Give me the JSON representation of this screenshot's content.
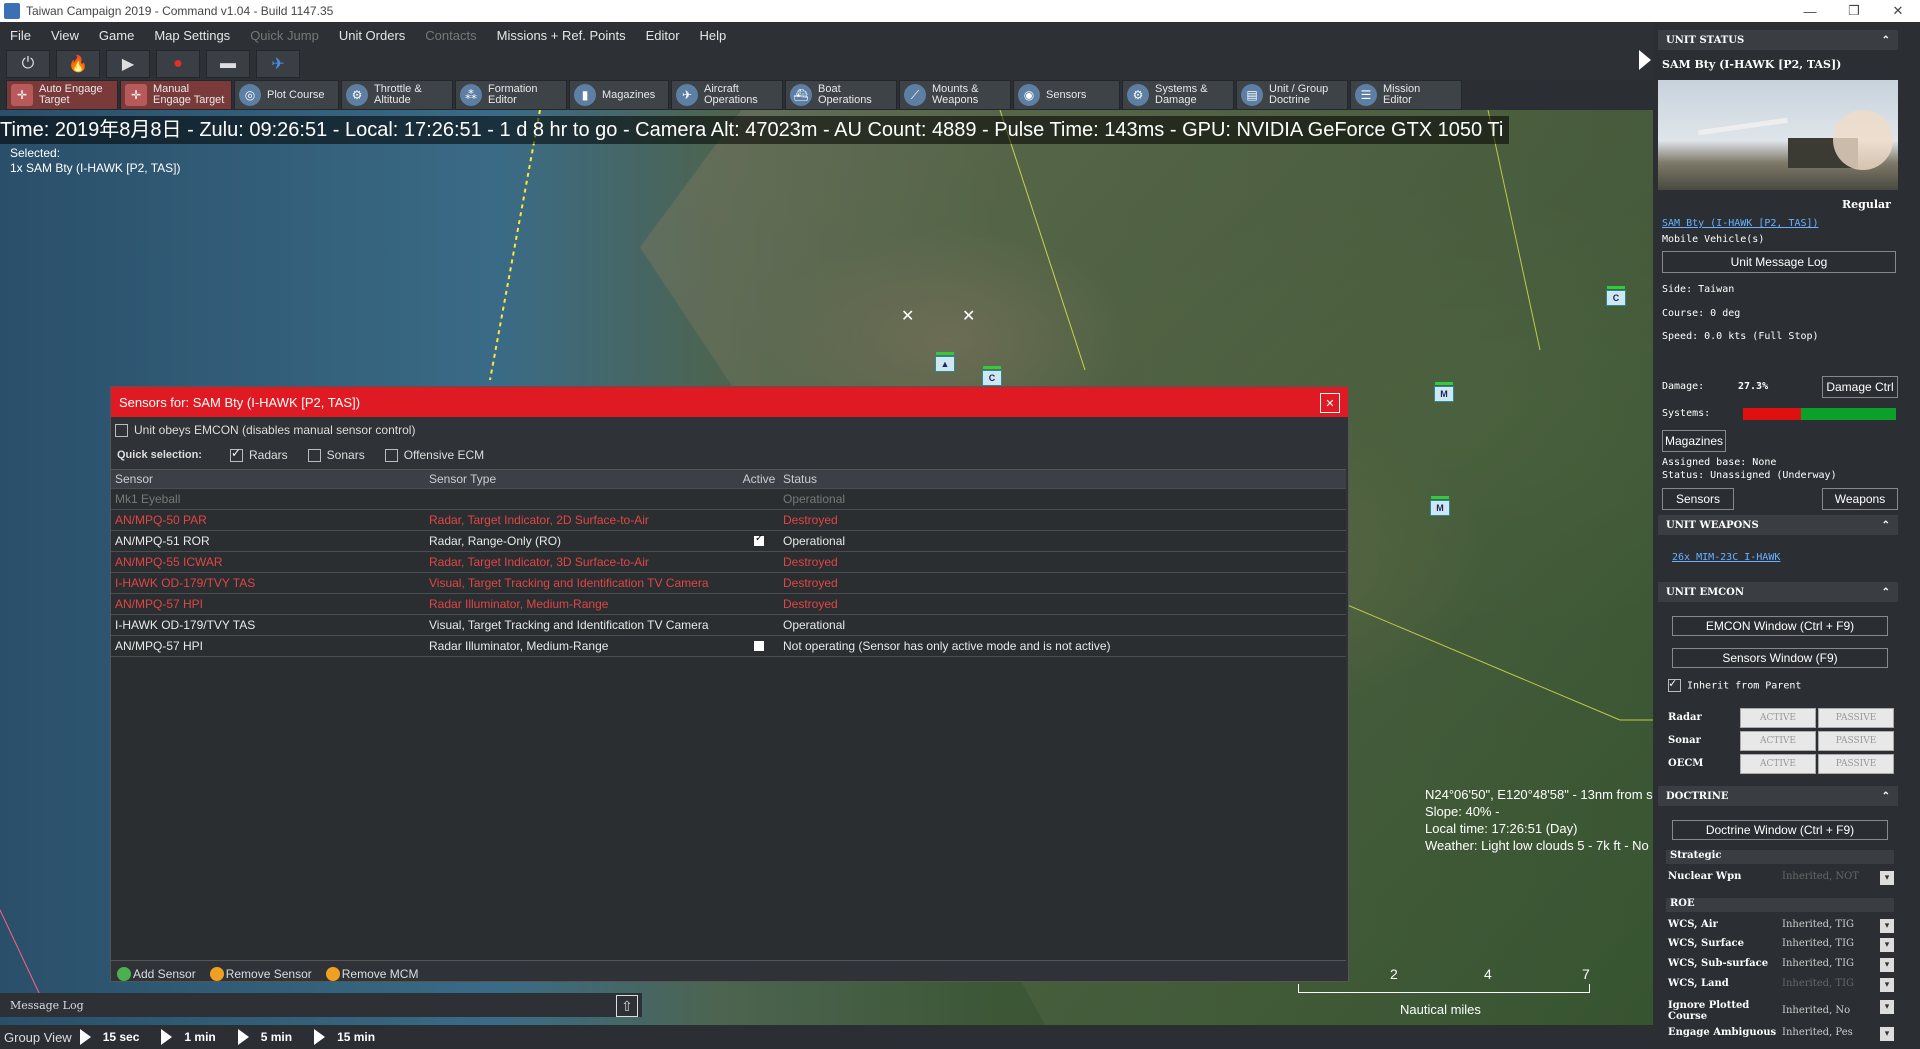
{
  "window": {
    "title": "Taiwan  Campaign 2019 - Command v1.04 - Build 1147.35"
  },
  "menu": [
    "File",
    "View",
    "Game",
    "Map Settings",
    "Quick Jump",
    "Unit Orders",
    "Contacts",
    "Missions + Ref. Points",
    "Editor",
    "Help"
  ],
  "menu_disabled": [
    "Quick Jump",
    "Contacts"
  ],
  "toolbar2": [
    {
      "label": "Auto Engage\nTarget",
      "icon": "crosshair-icon",
      "style": "red"
    },
    {
      "label": "Manual\nEngage Target",
      "icon": "crosshair-icon",
      "style": "red"
    },
    {
      "label": "Plot Course",
      "icon": "compass-icon",
      "style": "normal"
    },
    {
      "label": "Throttle &\nAltitude",
      "icon": "throttle-icon",
      "style": "normal"
    },
    {
      "label": "Formation\nEditor",
      "icon": "formation-icon",
      "style": "normal"
    },
    {
      "label": "Magazines",
      "icon": "magazine-icon",
      "style": "normal"
    },
    {
      "label": "Aircraft\nOperations",
      "icon": "aircraft-icon",
      "style": "normal"
    },
    {
      "label": "Boat\nOperations",
      "icon": "boat-icon",
      "style": "normal"
    },
    {
      "label": "Mounts &\nWeapons",
      "icon": "weapons-icon",
      "style": "normal"
    },
    {
      "label": "Sensors",
      "icon": "radar-icon",
      "style": "normal"
    },
    {
      "label": "Systems &\nDamage",
      "icon": "gear-icon",
      "style": "normal"
    },
    {
      "label": "Unit / Group\nDoctrine",
      "icon": "doctrine-icon",
      "style": "normal"
    },
    {
      "label": "Mission\nEditor",
      "icon": "mission-icon",
      "style": "normal"
    }
  ],
  "status_line": "Time: 2019年8月8日 - Zulu: 09:26:51 - Local: 17:26:51 - 1 d 8 hr to go  - Camera Alt: 47023m  - AU Count: 4889 - Pulse Time: 143ms - GPU: NVIDIA GeForce GTX 1050 Ti",
  "selected": {
    "label": "Selected:",
    "value": "1x SAM Bty (I-HAWK [P2, TAS])"
  },
  "map_info": [
    "N24°06'50\", E120°48'58\" - 13nm from s",
    "Slope: 40%  -",
    "Local time: 17:26:51 (Day)",
    "Weather: Light low clouds 5 - 7k ft - No"
  ],
  "scale": {
    "ticks": [
      "2",
      "4",
      "7"
    ],
    "unit": "Nautical miles"
  },
  "message_log": {
    "label": "Message Log"
  },
  "bottom_bar": {
    "group_view": "Group View",
    "time_steps": [
      "15 sec",
      "1 min",
      "5 min",
      "15 min"
    ]
  },
  "dialog": {
    "title": "Sensors for: SAM Bty (I-HAWK [P2, TAS])",
    "emcon_label": "Unit obeys EMCON (disables manual sensor control)",
    "quick_label": "Quick selection:",
    "quick_options": [
      {
        "label": "Radars",
        "checked": true
      },
      {
        "label": "Sonars",
        "checked": false
      },
      {
        "label": "Offensive ECM",
        "checked": false
      }
    ],
    "columns": [
      "Sensor",
      "Sensor Type",
      "Active",
      "Status"
    ],
    "rows": [
      {
        "sensor": "Mk1 Eyeball",
        "type": "",
        "active": null,
        "status": "Operational",
        "style": "gray"
      },
      {
        "sensor": "AN/MPQ-50 PAR",
        "type": "Radar, Target Indicator, 2D Surface-to-Air",
        "active": null,
        "status": "Destroyed",
        "style": "red"
      },
      {
        "sensor": "AN/MPQ-51 ROR",
        "type": "Radar, Range-Only (RO)",
        "active": true,
        "status": "Operational",
        "style": "norm"
      },
      {
        "sensor": "AN/MPQ-55 ICWAR",
        "type": "Radar, Target Indicator, 3D Surface-to-Air",
        "active": null,
        "status": "Destroyed",
        "style": "red"
      },
      {
        "sensor": "I-HAWK OD-179/TVY TAS",
        "type": "Visual, Target Tracking and Identification TV Camera",
        "active": null,
        "status": "Destroyed",
        "style": "red"
      },
      {
        "sensor": "AN/MPQ-57 HPI",
        "type": "Radar Illuminator, Medium-Range",
        "active": null,
        "status": "Destroyed",
        "style": "red"
      },
      {
        "sensor": "I-HAWK OD-179/TVY TAS",
        "type": "Visual, Target Tracking and Identification TV Camera",
        "active": null,
        "status": "Operational",
        "style": "norm"
      },
      {
        "sensor": "AN/MPQ-57 HPI",
        "type": "Radar Illuminator, Medium-Range",
        "active": false,
        "status": "Not operating (Sensor has only active mode and is not active)",
        "style": "norm"
      }
    ],
    "footer": [
      {
        "label": "Add Sensor",
        "color": "#4caf50"
      },
      {
        "label": "Remove Sensor",
        "color": "#f0a020"
      },
      {
        "label": "Remove MCM",
        "color": "#f0a020"
      }
    ]
  },
  "panel": {
    "unit_status_header": "UNIT STATUS",
    "unit_name": "SAM Bty (I-HAWK [P2, TAS])",
    "proficiency": "Regular",
    "unit_link": "SAM Bty (I-HAWK [P2, TAS])",
    "unit_type": "Mobile Vehicle(s)",
    "message_log_btn": "Unit Message Log",
    "side": "Side: Taiwan",
    "course": "Course: 0 deg",
    "speed": "Speed: 0.0 kts (Full Stop)",
    "damage_label": "Damage:",
    "damage_value": "27.3%",
    "damage_ctrl_btn": "Damage Ctrl",
    "systems_label": "Systems:",
    "systems_damage_fraction": 0.38,
    "magazines_btn": "Magazines",
    "assigned_base": "Assigned base: None",
    "status": "Status: Unassigned (Underway)",
    "sensors_btn": "Sensors",
    "weapons_btn": "Weapons",
    "unit_weapons_header": "UNIT WEAPONS",
    "weapon_link": "26x MIM-23C I-HAWK",
    "unit_emcon_header": "UNIT EMCON",
    "emcon_window_btn": "EMCON Window (Ctrl + F9)",
    "sensors_window_btn": "Sensors Window (F9)",
    "inherit_label": "Inherit from Parent",
    "emcon_rows": [
      {
        "label": "Radar",
        "active": "ACTIVE",
        "passive": "PASSIVE"
      },
      {
        "label": "Sonar",
        "active": "ACTIVE",
        "passive": "PASSIVE"
      },
      {
        "label": "OECM",
        "active": "ACTIVE",
        "passive": "PASSIVE"
      }
    ],
    "doctrine_header": "DOCTRINE",
    "doctrine_window_btn": "Doctrine Window (Ctrl + F9)",
    "strategic_label": "Strategic",
    "nuclear_label": "Nuclear Wpn",
    "nuclear_value": "Inherited, NOT",
    "roe_label": "ROE",
    "doctrine_rows": [
      {
        "label": "WCS, Air",
        "value": "Inherited, TIG",
        "dim": false
      },
      {
        "label": "WCS, Surface",
        "value": "Inherited, TIG",
        "dim": false
      },
      {
        "label": "WCS, Sub-surface",
        "value": "Inherited, TIG",
        "dim": false
      },
      {
        "label": "WCS, Land",
        "value": "Inherited, TIG",
        "dim": true
      },
      {
        "label": "Ignore Plotted\nCourse",
        "value": "Inherited, No",
        "dim": false
      },
      {
        "label": "Engage Ambiguous",
        "value": "Inherited, Pes",
        "dim": false
      }
    ]
  }
}
